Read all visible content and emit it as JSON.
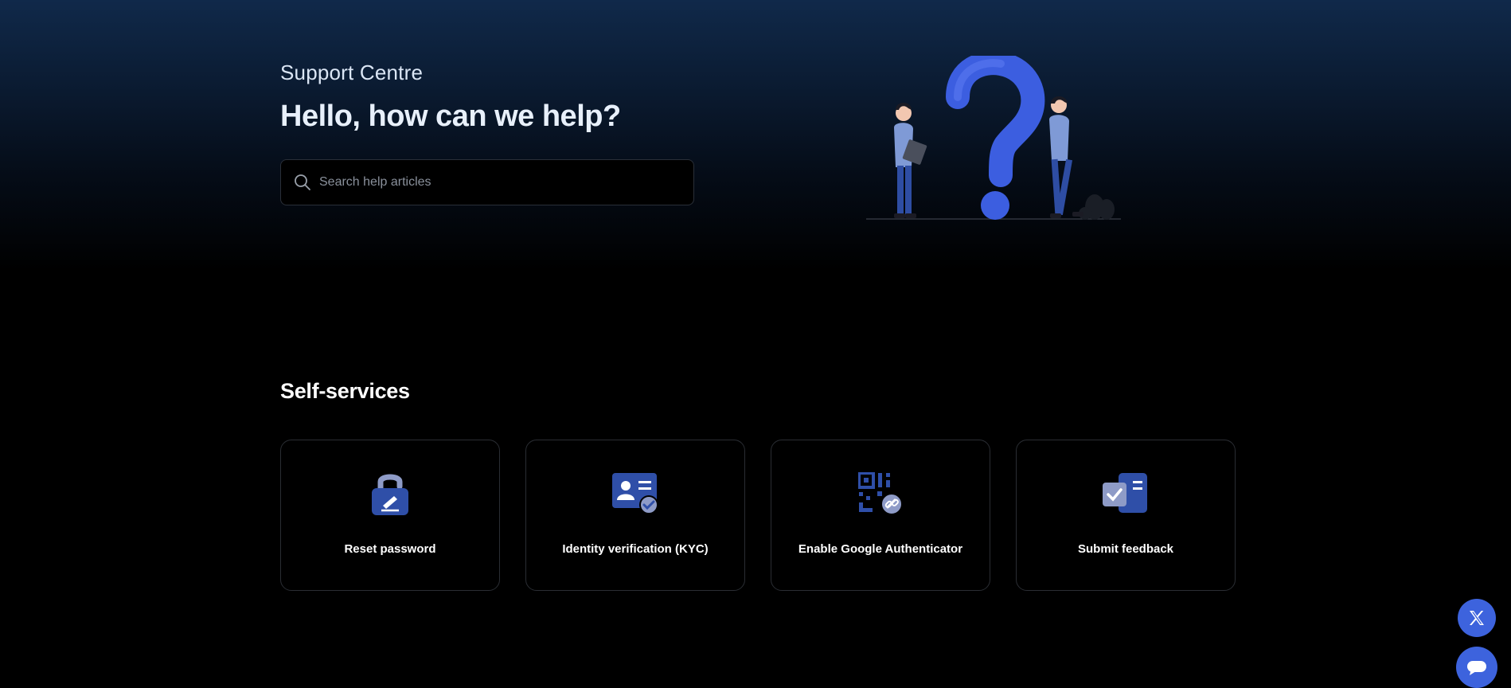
{
  "hero": {
    "subtitle": "Support Centre",
    "headline": "Hello, how can we help?",
    "search_placeholder": "Search help articles"
  },
  "self_services": {
    "title": "Self-services",
    "cards": [
      {
        "label": "Reset password",
        "icon": "unlock-pen-icon"
      },
      {
        "label": "Identity verification (KYC)",
        "icon": "id-card-check-icon"
      },
      {
        "label": "Enable Google Authenticator",
        "icon": "qr-code-link-icon"
      },
      {
        "label": "Submit feedback",
        "icon": "feedback-check-icon"
      }
    ]
  },
  "colors": {
    "accent": "#3d63dd",
    "icon_blue": "#2f4fa8",
    "icon_light": "#8e9bc7"
  }
}
